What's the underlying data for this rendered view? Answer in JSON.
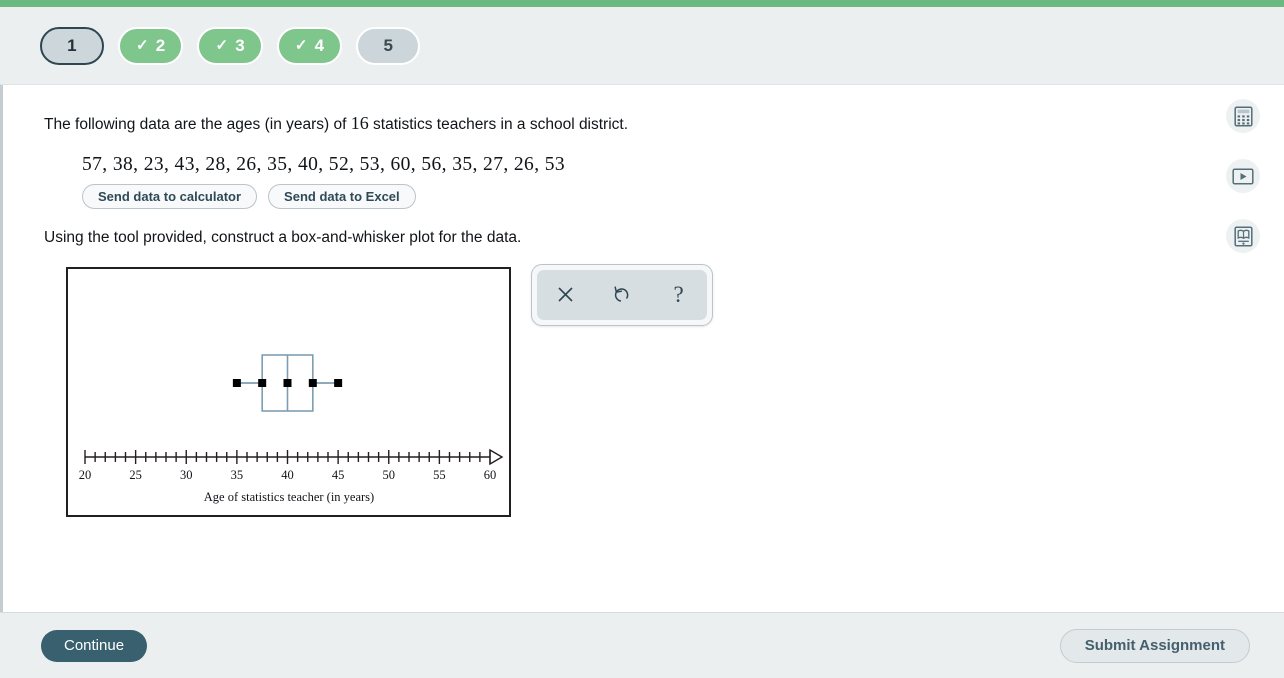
{
  "header": {
    "steps": [
      {
        "label": "1",
        "state": "current",
        "check": ""
      },
      {
        "label": "2",
        "state": "done",
        "check": "✓"
      },
      {
        "label": "3",
        "state": "done",
        "check": "✓"
      },
      {
        "label": "4",
        "state": "done",
        "check": "✓"
      },
      {
        "label": "5",
        "state": "todo",
        "check": ""
      }
    ]
  },
  "prompt": {
    "text_before": "The following data are the ages (in years) of ",
    "count": "16",
    "text_after": " statistics teachers in a school district.",
    "data_values": "57, 38, 23, 43, 28, 26, 35, 40, 52, 53, 60, 56, 35, 27, 26, 53",
    "send_calculator": "Send data to calculator",
    "send_excel": "Send data to Excel",
    "instruction": "Using the tool provided, construct a box-and-whisker plot for the data."
  },
  "toolbar": {
    "delete_icon": "close-x-icon",
    "undo_icon": "undo-arrow-icon",
    "help_icon": "question-mark-icon",
    "help_label": "?"
  },
  "rail": [
    {
      "icon": "calculator-icon",
      "name": "calculator"
    },
    {
      "icon": "video-play-icon",
      "name": "video"
    },
    {
      "icon": "reference-book-icon",
      "name": "reference"
    }
  ],
  "footer": {
    "continue_label": "Continue",
    "submit_label": "Submit Assignment"
  },
  "colors": {
    "progress_green": "#6bb881",
    "step_done": "#7ec68c",
    "step_current": "#cdd6da",
    "box_stroke": "#7d9eb2",
    "handle": "#000000",
    "continue_bg": "#38606e"
  },
  "chart_data": {
    "type": "box",
    "title": "",
    "xlabel": "Age of statistics teacher (in years)",
    "ylabel": "",
    "xlim": [
      20,
      60
    ],
    "x_tick_labels": [
      "20",
      "25",
      "30",
      "35",
      "40",
      "45",
      "50",
      "55",
      "60"
    ],
    "x_tick_values": [
      20,
      25,
      30,
      35,
      40,
      45,
      50,
      55,
      60
    ],
    "minor_tick_step": 1,
    "grid": false,
    "axis_arrow": true,
    "boxplot": {
      "min": 35,
      "q1": 37.5,
      "median": 40,
      "q3": 42.5,
      "max": 45,
      "handle_values": [
        35,
        37.5,
        40,
        42.5,
        45
      ]
    }
  }
}
